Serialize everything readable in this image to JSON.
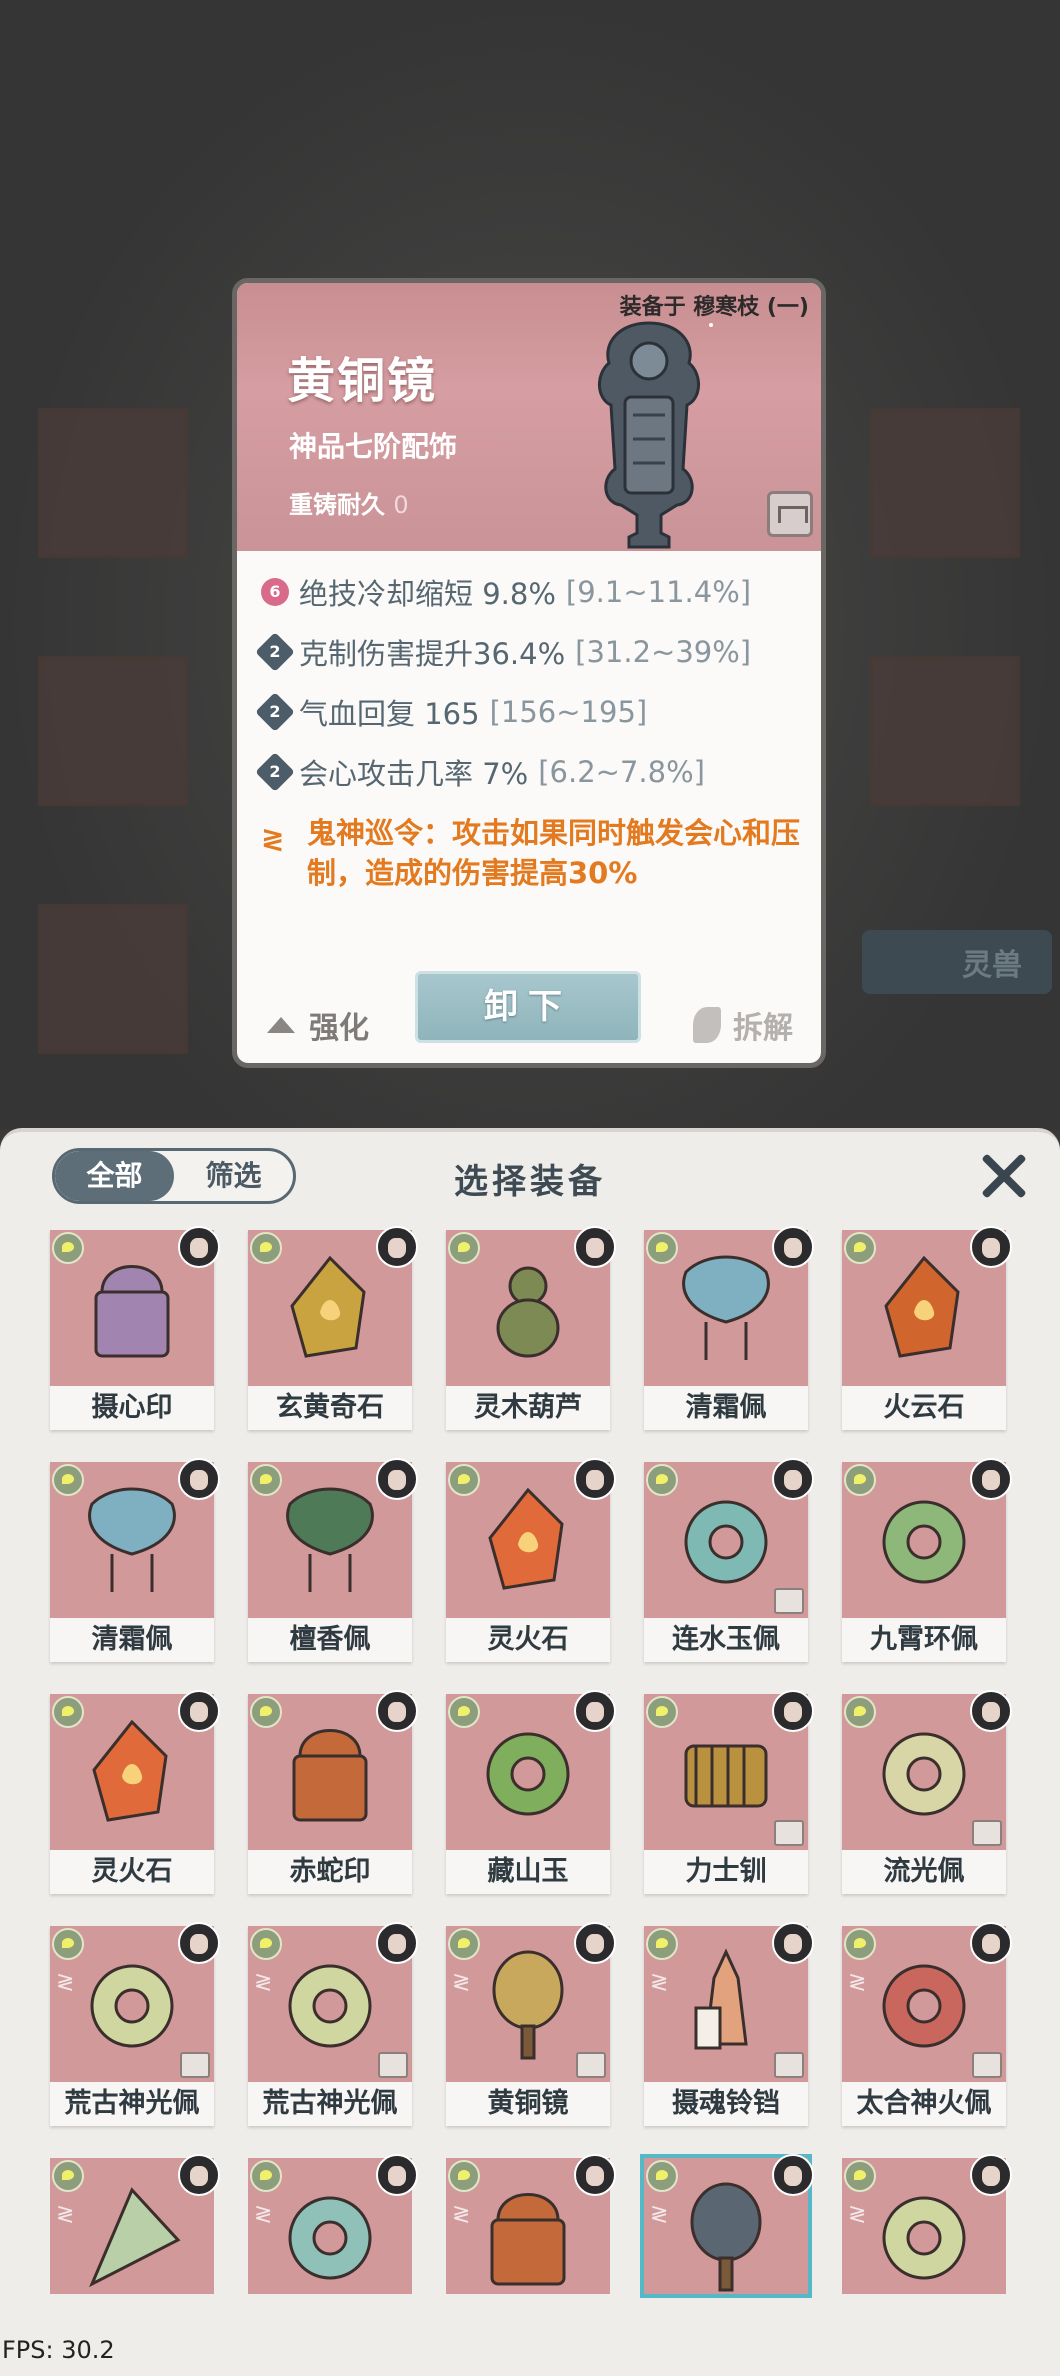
{
  "detail": {
    "equipped_on": "装备于 穆寒枝 (一)",
    "name": "黄铜镜",
    "grade": "神品七阶配饰",
    "recast_label": "重铸耐久",
    "recast_value": "0",
    "stats": [
      {
        "badge": "6",
        "text": "绝技冷却缩短 9.8%",
        "range": "[9.1~11.4%]"
      },
      {
        "badge": "2",
        "text": "克制伤害提升36.4%",
        "range": "[31.2~39%]"
      },
      {
        "badge": "2",
        "text": "气血回复 165",
        "range": "[156~195]"
      },
      {
        "badge": "2",
        "text": "会心攻击几率 7%",
        "range": "[6.2~7.8%]"
      }
    ],
    "special": "鬼神巡令：攻击如果同时触发会心和压制，造成的伤害提高30%",
    "unequip_label": "卸下",
    "enhance_label": "强化",
    "dismantle_label": "拆解"
  },
  "background": {
    "pet_label": "灵兽"
  },
  "panel": {
    "filter_all": "全部",
    "filter_select": "筛选",
    "title": "选择装备",
    "items": [
      {
        "name": "摄心印",
        "color": "#a184b0",
        "shape": "seal"
      },
      {
        "name": "玄黄奇石",
        "color": "#c9a33f",
        "shape": "stone"
      },
      {
        "name": "灵木葫芦",
        "color": "#7e8a54",
        "shape": "gourd"
      },
      {
        "name": "清霜佩",
        "color": "#7fb0c2",
        "shape": "pendant"
      },
      {
        "name": "火云石",
        "color": "#d0652d",
        "shape": "stone"
      },
      {
        "name": "清霜佩",
        "color": "#7fb0c2",
        "shape": "pendant"
      },
      {
        "name": "檀香佩",
        "color": "#4e7a58",
        "shape": "pendant"
      },
      {
        "name": "灵火石",
        "color": "#e06a3a",
        "shape": "stone"
      },
      {
        "name": "连水玉佩",
        "color": "#7eb9b4",
        "shape": "ring"
      },
      {
        "name": "九霄环佩",
        "color": "#8db87a",
        "shape": "ring"
      },
      {
        "name": "灵火石",
        "color": "#e06a3a",
        "shape": "stone"
      },
      {
        "name": "赤蛇印",
        "color": "#c46a3a",
        "shape": "seal"
      },
      {
        "name": "藏山玉",
        "color": "#7fae5c",
        "shape": "ring"
      },
      {
        "name": "力士钏",
        "color": "#b9913f",
        "shape": "coil"
      },
      {
        "name": "流光佩",
        "color": "#d8d6a6",
        "shape": "ring"
      },
      {
        "name": "荒古神光佩",
        "color": "#cfd6a0",
        "shape": "ring"
      },
      {
        "name": "荒古神光佩",
        "color": "#cfd6a0",
        "shape": "ring"
      },
      {
        "name": "黄铜镜",
        "color": "#c8a85c",
        "shape": "mirror"
      },
      {
        "name": "摄魂铃铛",
        "color": "#e3a27e",
        "shape": "bell"
      },
      {
        "name": "太合神火佩",
        "color": "#c9665e",
        "shape": "ring"
      },
      {
        "name": "",
        "color": "#b8cfa8",
        "shape": "fan"
      },
      {
        "name": "",
        "color": "#8fc1b8",
        "shape": "ring"
      },
      {
        "name": "",
        "color": "#c46a3a",
        "shape": "seal"
      },
      {
        "name": "",
        "color": "#5a6672",
        "shape": "mirror"
      },
      {
        "name": "",
        "color": "#cfd6a0",
        "shape": "ring"
      }
    ],
    "selected_index": 23
  },
  "fps": "FPS: 30.2"
}
